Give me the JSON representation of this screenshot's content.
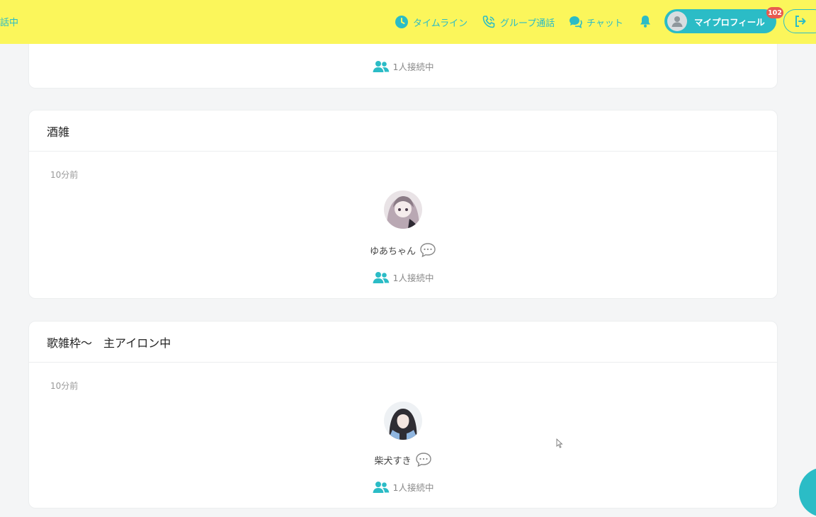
{
  "header": {
    "left_status": "話中",
    "nav": {
      "timeline": "タイムライン",
      "group_call": "グループ通話",
      "chat": "チャット"
    },
    "profile_label": "マイプロフィール",
    "notification_count": "102"
  },
  "rooms": [
    {
      "title": "",
      "time": "",
      "user_name": "",
      "participants": "1人接続中"
    },
    {
      "title": "酒雑",
      "time": "10分前",
      "user_name": "ゆあちゃん",
      "participants": "1人接続中"
    },
    {
      "title": "歌雑枠〜　主アイロン中",
      "time": "10分前",
      "user_name": "柴犬すき",
      "participants": "1人接続中"
    }
  ],
  "colors": {
    "accent": "#2bbcc6",
    "topbar": "#fbf65b",
    "badge": "#e85a4f"
  }
}
